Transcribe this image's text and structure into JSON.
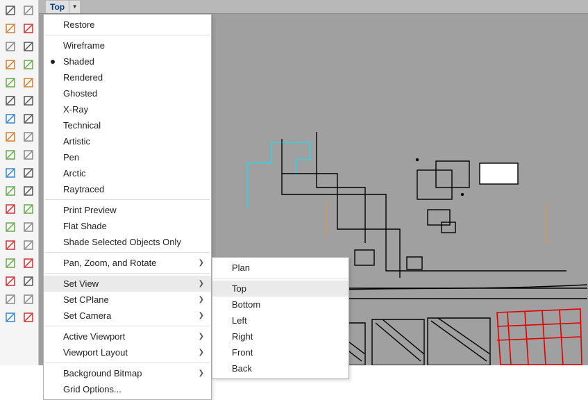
{
  "viewport": {
    "name": "Top"
  },
  "toolbar": {
    "rows": [
      [
        "pointer-icon",
        "lasso-icon"
      ],
      [
        "polyline-icon",
        "loop-icon"
      ],
      [
        "circle-icon",
        "spiral-icon"
      ],
      [
        "triangle-icon",
        "arc-icon"
      ],
      [
        "rect-icon",
        "polygon-icon"
      ],
      [
        "surface-icon",
        "deform-icon"
      ],
      [
        "box-icon",
        "sphere-icon"
      ],
      [
        "cylinder-icon",
        "torus-icon"
      ],
      [
        "gear-icon",
        "flame-icon"
      ],
      [
        "pin-icon",
        "mirror-icon"
      ],
      [
        "drop-icon",
        "offset-icon"
      ],
      [
        "curve-icon",
        "dup-icon"
      ],
      [
        "text-icon",
        "hatch-icon"
      ],
      [
        "blend-icon",
        "shell-icon"
      ],
      [
        "grid-icon",
        "snap-icon"
      ],
      [
        "array-icon",
        "layers-icon"
      ],
      [
        "render-icon",
        "check-icon"
      ],
      [
        "tag-icon",
        "flag-icon"
      ]
    ]
  },
  "menu": {
    "sections": [
      {
        "items": [
          {
            "label": "Restore"
          }
        ]
      },
      {
        "items": [
          {
            "label": "Wireframe"
          },
          {
            "label": "Shaded",
            "checked": true
          },
          {
            "label": "Rendered"
          },
          {
            "label": "Ghosted"
          },
          {
            "label": "X-Ray"
          },
          {
            "label": "Technical"
          },
          {
            "label": "Artistic"
          },
          {
            "label": "Pen"
          },
          {
            "label": "Arctic"
          },
          {
            "label": "Raytraced"
          }
        ]
      },
      {
        "items": [
          {
            "label": "Print Preview"
          },
          {
            "label": "Flat Shade"
          },
          {
            "label": "Shade Selected Objects Only"
          }
        ]
      },
      {
        "items": [
          {
            "label": "Pan, Zoom, and Rotate",
            "submenu": true
          }
        ]
      },
      {
        "items": [
          {
            "label": "Set View",
            "submenu": true,
            "hover": true
          },
          {
            "label": "Set CPlane",
            "submenu": true
          },
          {
            "label": "Set Camera",
            "submenu": true
          }
        ]
      },
      {
        "items": [
          {
            "label": "Active Viewport",
            "submenu": true
          },
          {
            "label": "Viewport Layout",
            "submenu": true
          }
        ]
      },
      {
        "items": [
          {
            "label": "Background Bitmap",
            "submenu": true
          },
          {
            "label": "Grid Options..."
          }
        ]
      }
    ],
    "submenu": {
      "items": [
        {
          "label": "Plan"
        },
        {
          "sep": true
        },
        {
          "label": "Top",
          "hover": true
        },
        {
          "label": "Bottom"
        },
        {
          "label": "Left"
        },
        {
          "label": "Right"
        },
        {
          "label": "Front"
        },
        {
          "label": "Back"
        }
      ]
    }
  }
}
